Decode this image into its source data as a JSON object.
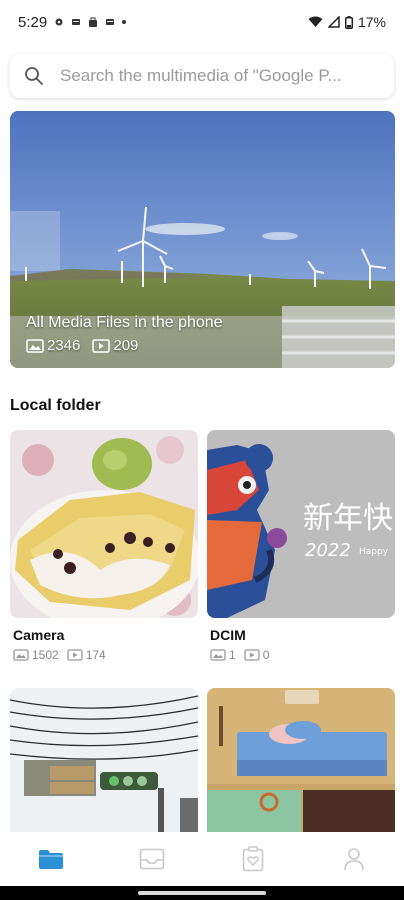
{
  "status_bar": {
    "time": "5:29",
    "battery": "17%"
  },
  "search": {
    "placeholder": "Search the multimedia of \"Google P..."
  },
  "hero": {
    "title": "All Media Files in the phone",
    "image_count": "2346",
    "video_count": "209"
  },
  "section": {
    "title": "Local folder"
  },
  "folders": [
    {
      "name": "Camera",
      "image_count": "1502",
      "video_count": "174"
    },
    {
      "name": "DCIM",
      "image_count": "1",
      "video_count": "0",
      "thumb_text_1": "新年快",
      "thumb_text_2": "2022",
      "thumb_text_3": "Happy"
    }
  ],
  "bottom_nav": {
    "items": [
      {
        "icon": "folder-icon",
        "active": true
      },
      {
        "icon": "inbox-icon",
        "active": false
      },
      {
        "icon": "clipboard-heart-icon",
        "active": false
      },
      {
        "icon": "person-icon",
        "active": false
      }
    ]
  },
  "colors": {
    "accent": "#2b8fd6",
    "inactive_icon": "#c8c8c8",
    "count_text": "#888888"
  }
}
